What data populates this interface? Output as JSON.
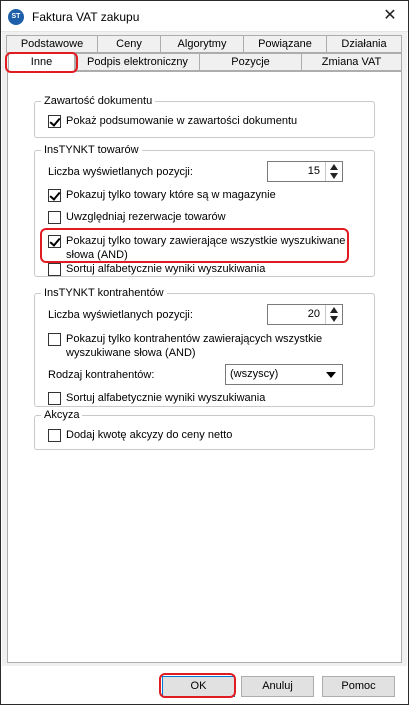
{
  "window": {
    "title": "Faktura VAT zakupu",
    "icon": "st-logo-icon"
  },
  "tabs_row1": [
    "Podstawowe",
    "Ceny",
    "Algorytmy",
    "Powiązane",
    "Działania"
  ],
  "tabs_row2": [
    "Inne",
    "Podpis elektroniczny",
    "Pozycje",
    "Zmiana VAT"
  ],
  "active_tab": "Inne",
  "groups": {
    "zawartosc": {
      "title": "Zawartość dokumentu",
      "summary_label": "Pokaż podsumowanie w zawartości dokumentu",
      "summary_checked": true
    },
    "towary": {
      "title": "InsTYNKT towarów",
      "count_label": "Liczba wyświetlanych pozycji:",
      "count_value": "15",
      "opt1_label": "Pokazuj tylko towary które są w magazynie",
      "opt1_checked": true,
      "opt2_label": "Uwzględniaj rezerwacje towarów",
      "opt2_checked": false,
      "opt3_label": "Pokazuj tylko towary zawierające wszystkie wyszukiwane słowa (AND)",
      "opt3_checked": true,
      "opt4_label": "Sortuj alfabetycznie wyniki wyszukiwania",
      "opt4_checked": false
    },
    "kontrahenci": {
      "title": "InsTYNKT kontrahentów",
      "count_label": "Liczba wyświetlanych pozycji:",
      "count_value": "20",
      "opt1_label": "Pokazuj tylko kontrahentów zawierających wszystkie wyszukiwane słowa (AND)",
      "opt1_checked": false,
      "kind_label": "Rodzaj kontrahentów:",
      "kind_value": "(wszyscy)",
      "opt2_label": "Sortuj alfabetycznie wyniki wyszukiwania",
      "opt2_checked": false
    },
    "akcyza": {
      "title": "Akcyza",
      "opt1_label": "Dodaj kwotę akcyzy do ceny netto",
      "opt1_checked": false
    }
  },
  "buttons": {
    "ok": "OK",
    "cancel": "Anuluj",
    "help": "Pomoc"
  },
  "colors": {
    "highlight": "#e11b22",
    "focus": "#0078d7"
  }
}
